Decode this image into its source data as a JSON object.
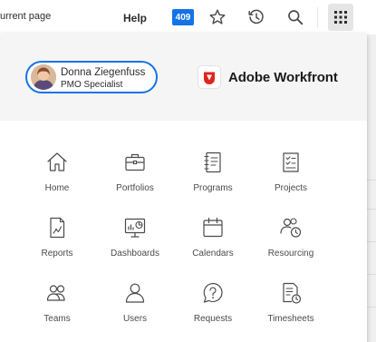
{
  "topbar": {
    "breadcrumb": "urrent page",
    "help_label": "Help",
    "notification_count": "409",
    "icons": [
      "star-icon",
      "history-icon",
      "search-icon",
      "apps-grid-icon"
    ],
    "accent_color": "#1473e6"
  },
  "user": {
    "name": "Donna Ziegenfuss",
    "role": "PMO Specialist"
  },
  "brand": {
    "name": "Adobe Workfront",
    "logo_color": "#e0251b"
  },
  "apps": [
    {
      "label": "Home",
      "icon": "home-icon"
    },
    {
      "label": "Portfolios",
      "icon": "briefcase-icon"
    },
    {
      "label": "Programs",
      "icon": "notebook-icon"
    },
    {
      "label": "Projects",
      "icon": "clipboard-check-icon"
    },
    {
      "label": "Reports",
      "icon": "report-chart-icon"
    },
    {
      "label": "Dashboards",
      "icon": "dashboard-monitor-icon"
    },
    {
      "label": "Calendars",
      "icon": "calendar-icon"
    },
    {
      "label": "Resourcing",
      "icon": "resourcing-people-clock-icon"
    },
    {
      "label": "Teams",
      "icon": "team-icon"
    },
    {
      "label": "Users",
      "icon": "user-icon"
    },
    {
      "label": "Requests",
      "icon": "question-bubble-icon"
    },
    {
      "label": "Timesheets",
      "icon": "timesheet-icon"
    }
  ]
}
